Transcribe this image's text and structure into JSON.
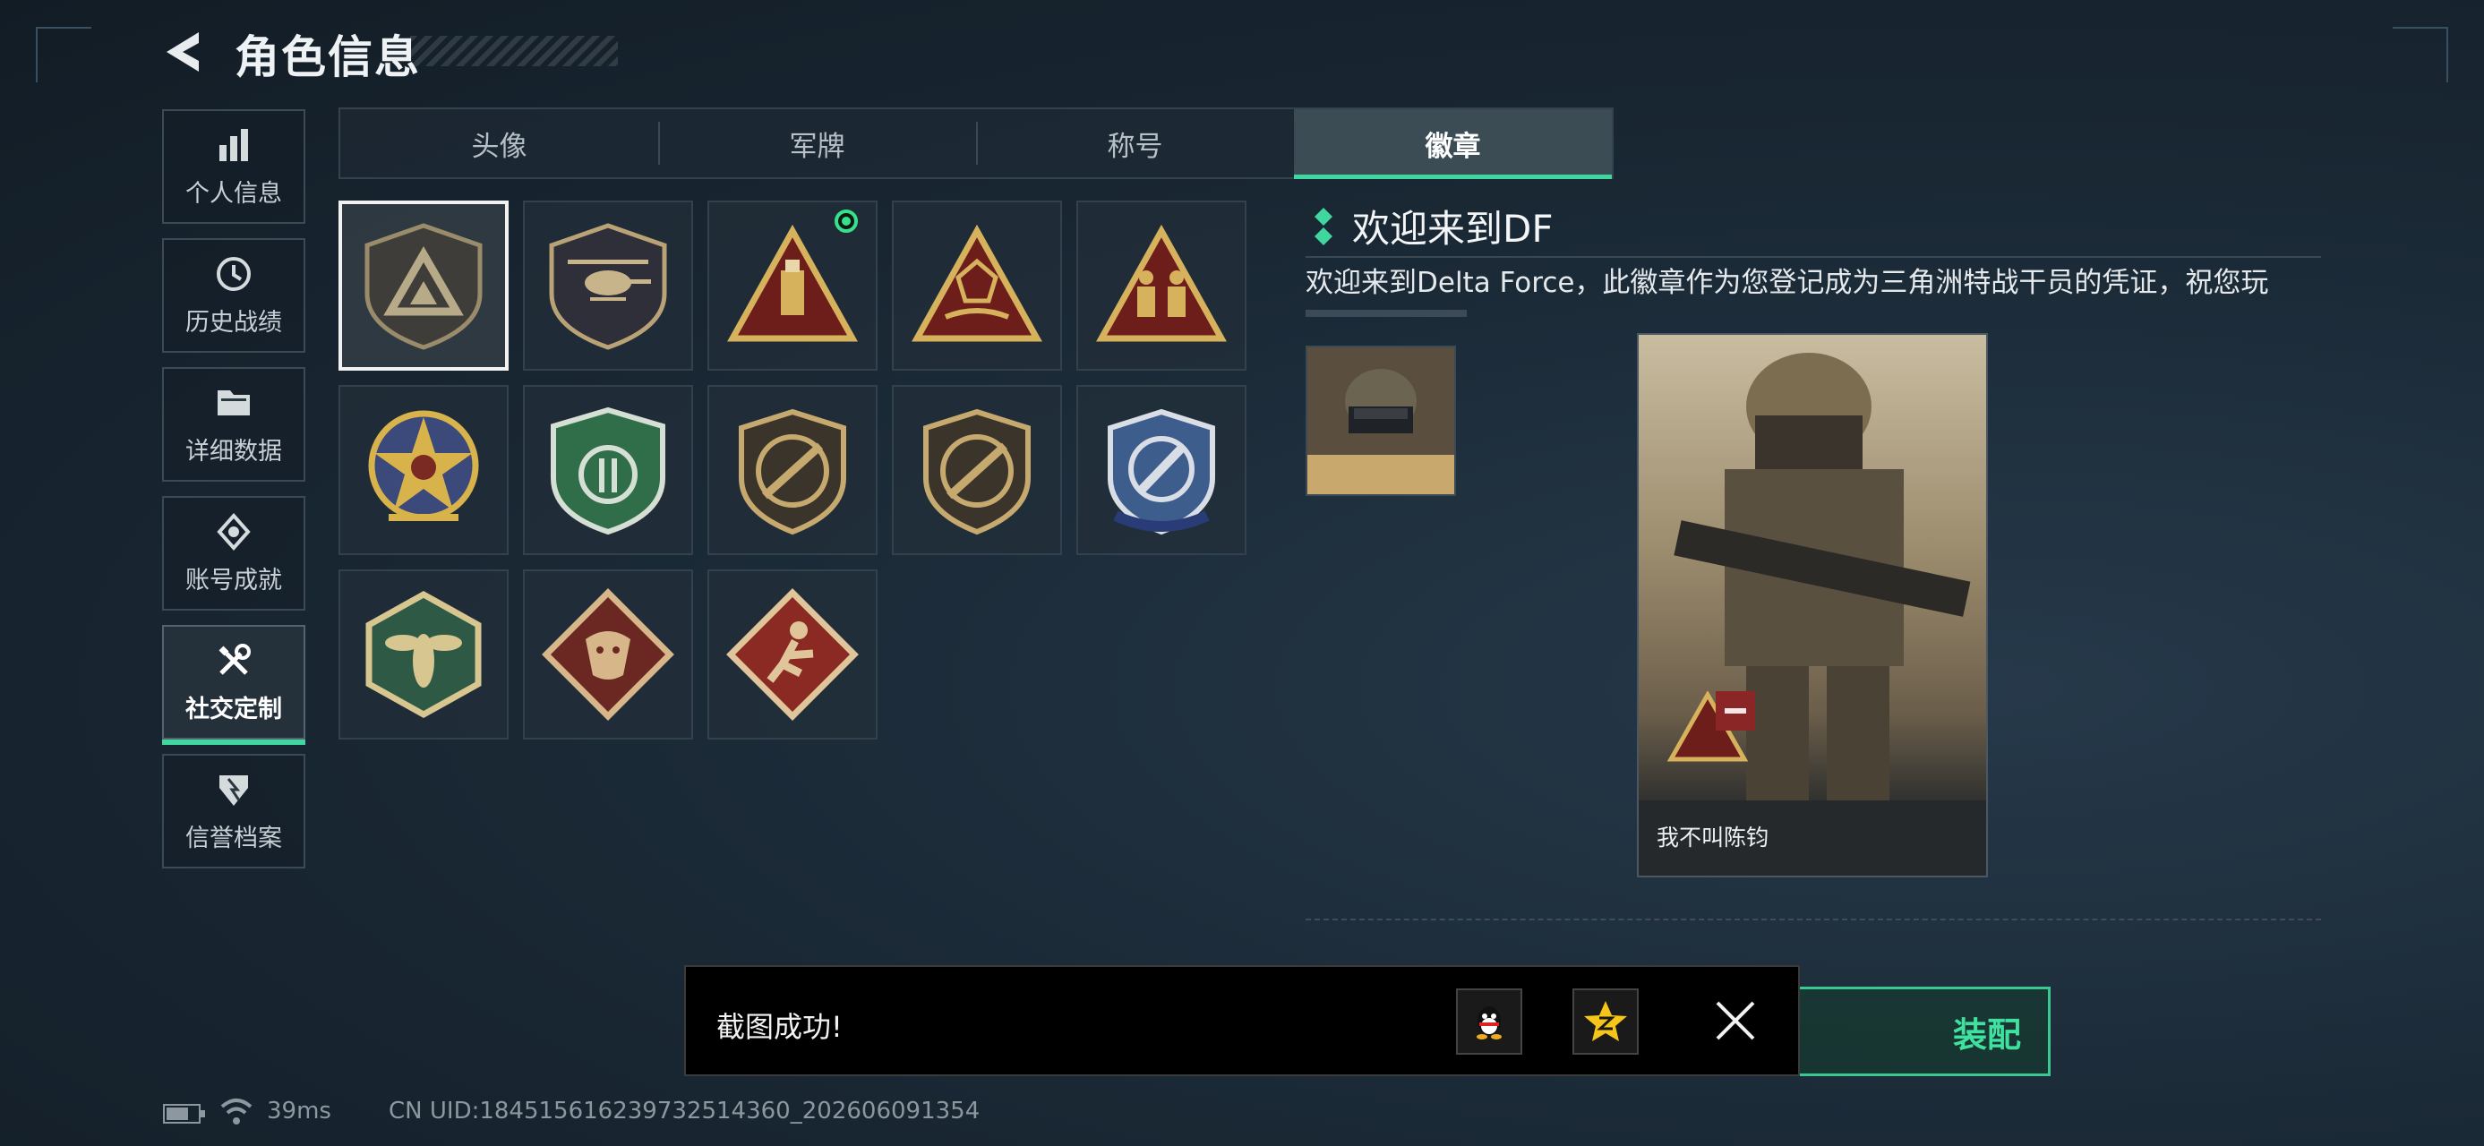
{
  "header": {
    "title": "角色信息"
  },
  "sidebar": {
    "items": [
      {
        "label": "个人信息",
        "icon": "bar-chart-icon"
      },
      {
        "label": "历史战绩",
        "icon": "history-icon"
      },
      {
        "label": "详细数据",
        "icon": "folder-icon"
      },
      {
        "label": "账号成就",
        "icon": "achievement-icon"
      },
      {
        "label": "社交定制",
        "icon": "tools-icon",
        "active": true
      },
      {
        "label": "信誉档案",
        "icon": "credit-shield-icon"
      }
    ]
  },
  "tabs": [
    {
      "label": "头像"
    },
    {
      "label": "军牌"
    },
    {
      "label": "称号"
    },
    {
      "label": "徽章",
      "active": true
    }
  ],
  "badges": [
    {
      "name": "triangle-shield-badge",
      "selected": true
    },
    {
      "name": "helicopter-badge"
    },
    {
      "name": "usb-triangle-badge",
      "new": true
    },
    {
      "name": "gem-hands-badge"
    },
    {
      "name": "soldiers-triangle-badge"
    },
    {
      "name": "star-compass-badge"
    },
    {
      "name": "green-shield-badge"
    },
    {
      "name": "rifle-badge-1"
    },
    {
      "name": "rifle-badge-2"
    },
    {
      "name": "crosshair-knife-badge"
    },
    {
      "name": "wasp-hexagon-badge"
    },
    {
      "name": "dragon-diamond-badge"
    },
    {
      "name": "runner-diamond-badge"
    }
  ],
  "detail": {
    "title": "欢迎来到DF",
    "description": "欢迎来到Delta Force，此徽章作为您登记成为三角洲特战干员的凭证，祝您玩",
    "player_name": "我不叫陈钧"
  },
  "equip_button": {
    "label": "装配"
  },
  "toast": {
    "message": "截图成功!"
  },
  "status": {
    "ping": "39ms",
    "uid": "CN UID:184515616239732514360_202606091354"
  },
  "colors": {
    "accent": "#3fd6a0",
    "new_dot": "#39e08c"
  }
}
